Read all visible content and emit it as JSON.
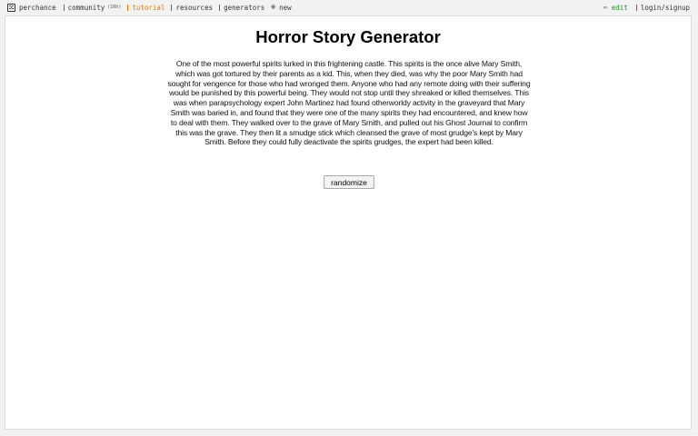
{
  "nav": {
    "home": {
      "label": "perchance",
      "icon": "dice-icon"
    },
    "community": {
      "label": "community",
      "count": "(10h)",
      "icon": "community-icon"
    },
    "tutorial": {
      "label": "tutorial",
      "icon": "tutorial-icon",
      "color": "#e07b00"
    },
    "resources": {
      "label": "resources",
      "icon": "resources-icon"
    },
    "generators": {
      "label": "generators",
      "icon": "generators-icon"
    },
    "new": {
      "label": "new",
      "icon": "plus-circle-icon"
    },
    "edit": {
      "label": "edit",
      "icon": "pencil-icon",
      "color": "#2e8b2e"
    },
    "login": {
      "label": "login/signup",
      "icon": "user-icon"
    }
  },
  "main": {
    "title": "Horror Story Generator",
    "story": "One of the most powerful spirits lurked in this frightening castle. This spirits is the once alive Mary Smith, which was got tortured by their parents as a kid. This, when they died, was why the poor Mary Smith had sought for vengence for those who had wronged them. Anyone who had any remote doing with their suffering would be punished by this powerful being. They would not stop until they shreaked or killed themselves. This was when parapsychology expert John Martinez had found otherworldy activity in the graveyard that Mary Smith was baried in, and found that they were one of the many spirits they had encountered, and knew how to deal with them. They walked over to the grave of Mary Smith, and pulled out his Ghost Journal to confirm this was the grave. They then lit a smudge stick which cleansed the grave of most grudge's kept by Mary Smith. Before they could fully deactivate the spirits grudges, the expert had been killed.",
    "randomize_label": "randomize"
  }
}
